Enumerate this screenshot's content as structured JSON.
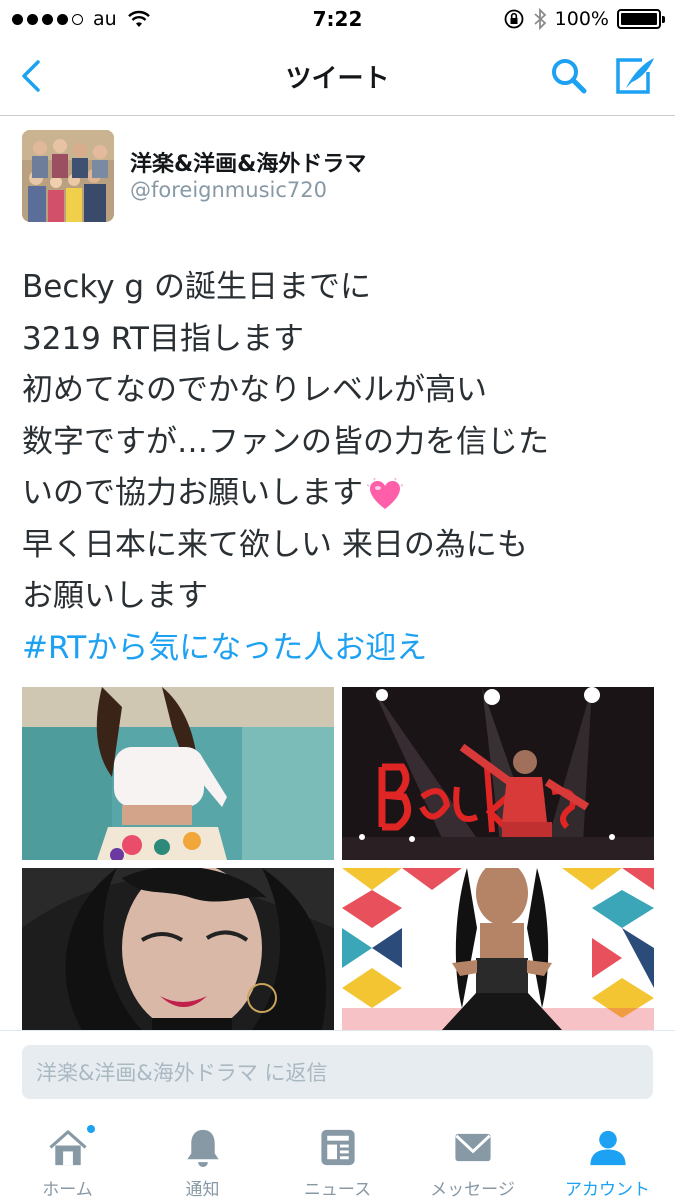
{
  "status_bar": {
    "carrier": "au",
    "time": "7:22",
    "battery_text": "100%",
    "battery_level": 1.0
  },
  "nav": {
    "title": "ツイート",
    "back_icon": "chevron-left-icon",
    "search_icon": "search-icon",
    "compose_icon": "compose-icon"
  },
  "tweet": {
    "display_name": "洋楽&洋画&海外ドラマ",
    "handle": "@foreignmusic720",
    "lines": [
      "Becky g の誕生日までに",
      "3219 RT目指します",
      "初めてなのでかなりレベルが高い",
      "数字ですが…ファンの皆の力を信じた",
      "いので協力お願いします",
      "早く日本に来て欲しい  来日の為にも",
      "お願いします"
    ],
    "hashtag": "#RTから気になった人お迎え"
  },
  "reply": {
    "placeholder": "洋楽&洋画&海外ドラマ に返信"
  },
  "tabs": [
    {
      "label": "ホーム",
      "icon": "home-icon"
    },
    {
      "label": "通知",
      "icon": "bell-icon"
    },
    {
      "label": "ニュース",
      "icon": "news-icon"
    },
    {
      "label": "メッセージ",
      "icon": "envelope-icon"
    },
    {
      "label": "アカウント",
      "icon": "person-icon"
    }
  ],
  "colors": {
    "accent": "#1da1f2",
    "inactive": "#8899a6",
    "text": "#292f33"
  }
}
